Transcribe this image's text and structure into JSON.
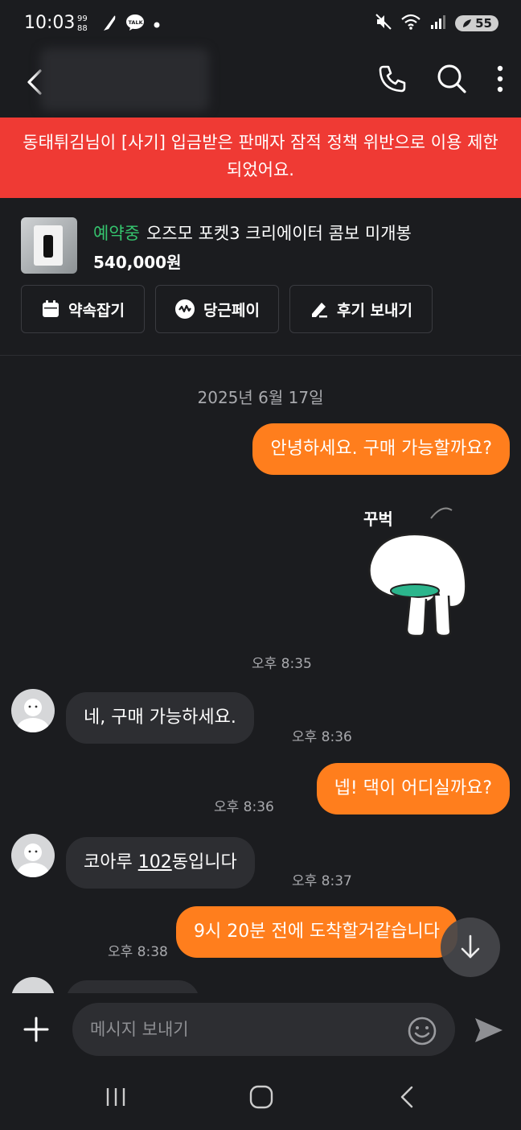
{
  "status_bar": {
    "time": "10:03",
    "battery": "55",
    "icons": [
      "gallery-icon",
      "feather-icon",
      "kakaotalk-icon",
      "dot-icon",
      "mute-icon",
      "wifi-icon",
      "signal-icon",
      "battery-icon"
    ],
    "kakao_label": "TALK"
  },
  "header": {
    "icons": [
      "back-icon",
      "phone-icon",
      "search-icon",
      "more-icon"
    ]
  },
  "warning": {
    "text": "동태튀김님이 [사기] 입금받은 판매자 잠적 정책 위반으로 이용 제한되었어요."
  },
  "product": {
    "status": "예약중",
    "title": "오즈모 포켓3 크리에이터 콤보 미개봉",
    "price": "540,000원",
    "status_color": "#35c46e",
    "actions": [
      {
        "label": "약속잡기",
        "icon": "calendar-icon"
      },
      {
        "label": "당근페이",
        "icon": "pay-icon"
      },
      {
        "label": "후기 보내기",
        "icon": "pencil-icon"
      }
    ]
  },
  "chat": {
    "date": "2025년 6월 17일",
    "messages": [
      {
        "sender": "me",
        "text": "안녕하세요. 구매 가능할까요?"
      },
      {
        "sender": "me",
        "type": "sticker",
        "sticker_text": "꾸벅",
        "time": "오후 8:35"
      },
      {
        "sender": "them",
        "text": "네, 구매 가능하세요.",
        "time": "오후 8:36"
      },
      {
        "sender": "me",
        "text": "넵! 댁이 어디실까요?",
        "time": "오후 8:36"
      },
      {
        "sender": "them",
        "text_prefix": "코아루 ",
        "text_link": "102",
        "text_suffix": "동입니다",
        "time": "오후 8:37"
      },
      {
        "sender": "me",
        "text": "9시 20분 전에 도착할거같습니다",
        "time": "오후 8:38"
      }
    ]
  },
  "input": {
    "placeholder": "메시지 보내기"
  },
  "colors": {
    "background": "#1b1c1f",
    "accent": "#ff7e1d",
    "warning": "#ef3a34",
    "bubble_other": "#2d2e32"
  },
  "nav": {
    "icons": [
      "recent-apps-icon",
      "home-icon",
      "back-nav-icon"
    ]
  }
}
